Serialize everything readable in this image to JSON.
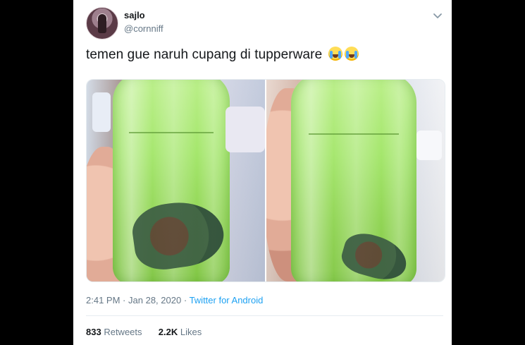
{
  "user": {
    "display_name": "sajlo",
    "handle": "@cornniff"
  },
  "tweet": {
    "text": "temen gue naruh cupang di tupperware",
    "emoji": [
      "loudly-crying-face",
      "loudly-crying-face"
    ]
  },
  "meta": {
    "time": "2:41 PM",
    "separator": "·",
    "date": "Jan 28, 2020",
    "source": "Twitter for Android"
  },
  "stats": {
    "retweets_count": "833",
    "retweets_label": "Retweets",
    "likes_count": "2.2K",
    "likes_label": "Likes"
  },
  "icons": {
    "menu": "chevron-down-icon"
  },
  "colors": {
    "link": "#1da1f2",
    "text": "#14171a",
    "muted": "#657786"
  }
}
